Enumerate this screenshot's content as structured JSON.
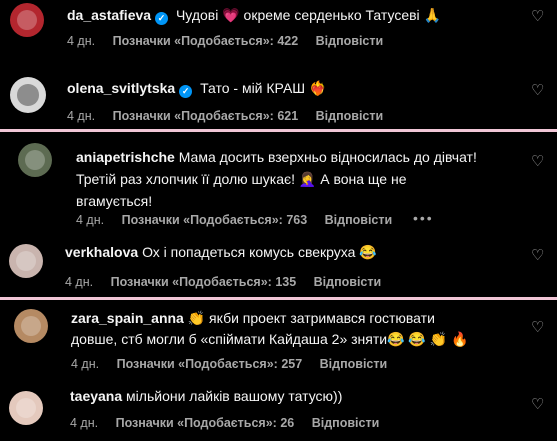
{
  "comments": [
    {
      "username": "da_astafieva",
      "verified": true,
      "text": "Чудові 💗 окреме серденько Татусеві 🙏",
      "time": "4 дн.",
      "likes": "Позначки «Подобається»: 422",
      "reply": "Відповісти",
      "avatar_color": "#b3262e"
    },
    {
      "username": "olena_svitlytska",
      "verified": true,
      "text": "Тато - мій КРАШ ❤️‍🔥",
      "time": "4 дн.",
      "likes": "Позначки «Подобається»: 621",
      "reply": "Відповісти",
      "avatar_color": "#d9d9d9"
    },
    {
      "username": "aniapetrishche",
      "verified": false,
      "text_line1": "Мама досить взерхньо відносилась до дівчат!",
      "text_line2": "Третій раз хлопчик її долю шукає! 🤦‍♀️ А вона ще не",
      "text_line3": "вгамується!",
      "time": "4 дн.",
      "likes": "Позначки «Подобається»: 763",
      "reply": "Відповісти",
      "avatar_color": "#5d6b52"
    },
    {
      "username": "verkhalova",
      "verified": false,
      "text": "Ох і попадеться комусь свекруха 😂",
      "time": "4 дн.",
      "likes": "Позначки «Подобається»: 135",
      "reply": "Відповісти",
      "avatar_color": "#c9b4ae"
    },
    {
      "username": "zara_spain_anna",
      "verified": false,
      "text_line1": "👏 якби проект затримався гостювати",
      "text_line2": "довше, стб могли б «спіймати Кайдаша 2» зняти😂 😂 👏 🔥",
      "time": "4 дн.",
      "likes": "Позначки «Подобається»: 257",
      "reply": "Відповісти",
      "avatar_color": "#b58a63"
    },
    {
      "username": "taeyana",
      "verified": false,
      "text": "мільйони лайків вашому татусю))",
      "time": "4 дн.",
      "likes": "Позначки «Подобається»: 26",
      "reply": "Відповісти",
      "avatar_color": "#e4c9bd"
    }
  ],
  "more_options": "•••",
  "colors": {
    "accent_verified": "#0095f6",
    "divider": "#f0c6d6",
    "muted": "#a8a8a8"
  }
}
